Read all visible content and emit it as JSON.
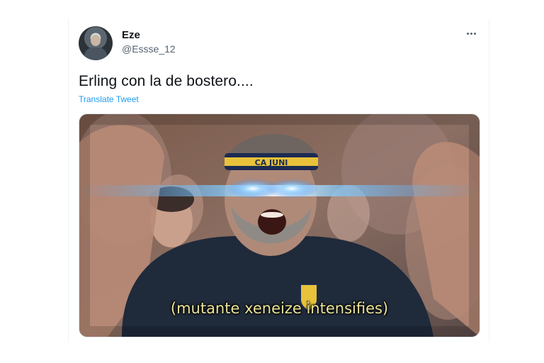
{
  "tweet": {
    "author": {
      "display_name": "Eze",
      "handle": "@Essse_12"
    },
    "text": "Erling con la de bostero....",
    "translate_label": "Translate Tweet",
    "media": {
      "subtitle": "(mutante xeneize intensifies)",
      "headband_text": "CA JUNI"
    }
  },
  "colors": {
    "link": "#1d9bf0",
    "text": "#0f1419",
    "secondary": "#536471",
    "subtitle": "#ebe49a"
  },
  "icons": [
    "more-options-icon",
    "avatar-image"
  ]
}
